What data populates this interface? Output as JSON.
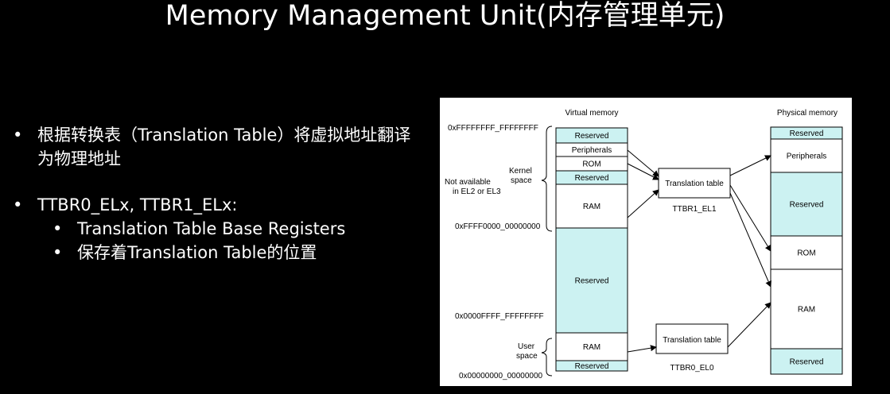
{
  "slide": {
    "title": "Memory Management Unit(内存管理单元)",
    "bullets": [
      {
        "text": "根据转换表（Translation Table）将虚拟地址翻译为物理地址"
      },
      {
        "text": "TTBR0_ELx, TTBR1_ELx:"
      },
      {
        "text": "Translation Table Base Registers"
      },
      {
        "text": "保存着Translation Table的位置"
      }
    ],
    "bullet_symbol": "•"
  },
  "diagram": {
    "colors": {
      "reserved_fill": "#ccf2f2",
      "block_fill": "#ffffff",
      "stroke": "#000000",
      "background": "#ffffff"
    },
    "virtual_memory": {
      "heading": "Virtual memory",
      "blocks": [
        {
          "label": "Reserved",
          "type": "reserved"
        },
        {
          "label": "Peripherals",
          "type": "normal"
        },
        {
          "label": "ROM",
          "type": "normal"
        },
        {
          "label": "Reserved",
          "type": "reserved"
        },
        {
          "label": "RAM",
          "type": "normal"
        },
        {
          "label": "Reserved",
          "type": "reserved"
        },
        {
          "label": "RAM",
          "type": "normal"
        },
        {
          "label": "Reserved",
          "type": "reserved"
        }
      ]
    },
    "physical_memory": {
      "heading": "Physical memory",
      "blocks": [
        {
          "label": "Reserved",
          "type": "reserved"
        },
        {
          "label": "Peripherals",
          "type": "normal"
        },
        {
          "label": "Reserved",
          "type": "reserved"
        },
        {
          "label": "ROM",
          "type": "normal"
        },
        {
          "label": "RAM",
          "type": "normal"
        },
        {
          "label": "Reserved",
          "type": "reserved"
        }
      ]
    },
    "address_labels": {
      "kernel_top": "0xFFFFFFFF_FFFFFFFF",
      "kernel_bottom": "0xFFFF0000_00000000",
      "user_top": "0x0000FFFF_FFFFFFFF",
      "user_bottom": "0x00000000_00000000"
    },
    "annotations": {
      "not_available_line1": "Not available",
      "not_available_line2": "in EL2 or EL3",
      "kernel_space_line1": "Kernel",
      "kernel_space_line2": "space",
      "user_space_line1": "User",
      "user_space_line2": "space"
    },
    "translation_tables": {
      "upper": {
        "label": "Translation table",
        "register": "TTBR1_EL1"
      },
      "lower": {
        "label": "Translation table",
        "register": "TTBR0_EL0"
      }
    }
  }
}
